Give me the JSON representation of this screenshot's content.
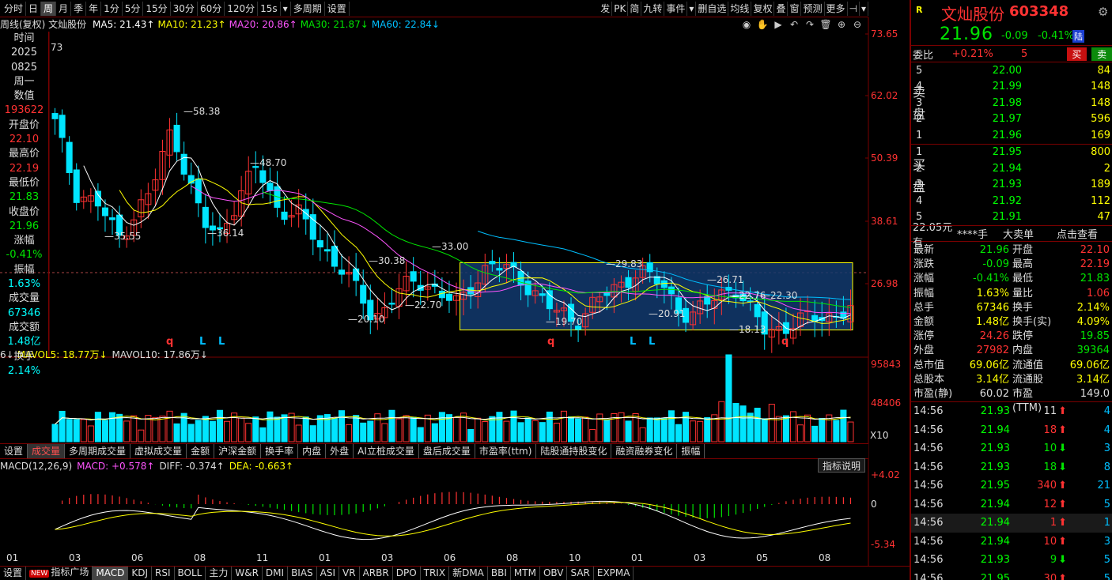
{
  "toolbar": {
    "left_items": [
      "分时",
      "日",
      "周",
      "月",
      "季",
      "年",
      "1分",
      "5分",
      "15分",
      "30分",
      "60分",
      "120分",
      "15s",
      "▾",
      "多周期",
      "设置"
    ],
    "active": "周",
    "right_items": [
      "发",
      "PK",
      "简",
      "九转",
      "事件",
      "▾",
      "删自选",
      "均线",
      "复权",
      "叠",
      "窗",
      "预测",
      "更多",
      "⊣",
      "▾"
    ]
  },
  "ma_line": {
    "title": "周线(复权) 文灿股份",
    "items": [
      {
        "text": "MA5: 21.43↑",
        "color": "#ffffff"
      },
      {
        "text": "MA10: 21.23↑",
        "color": "#ffff00"
      },
      {
        "text": "MA20: 20.86↑",
        "color": "#ff55ff"
      },
      {
        "text": "MA30: 21.87↓",
        "color": "#00e600"
      },
      {
        "text": "MA60: 22.84↓",
        "color": "#00bfff"
      }
    ]
  },
  "tools": [
    "◉",
    "✋",
    "▶",
    "↶",
    "↷",
    "🗑",
    "⊕",
    "⊖"
  ],
  "info_panel": [
    {
      "text": "时间",
      "color": "#ddd"
    },
    {
      "text": "2025",
      "color": "#ddd"
    },
    {
      "text": "0825",
      "color": "#ddd"
    },
    {
      "text": "周一",
      "color": "#ddd"
    },
    {
      "text": "数值",
      "color": "#ddd"
    },
    {
      "text": "193622",
      "color": "#ff3232"
    },
    {
      "text": "开盘价",
      "color": "#ddd"
    },
    {
      "text": "22.10",
      "color": "#ff3232"
    },
    {
      "text": "最高价",
      "color": "#ddd"
    },
    {
      "text": "22.19",
      "color": "#ff3232"
    },
    {
      "text": "最低价",
      "color": "#ddd"
    },
    {
      "text": "21.83",
      "color": "#00e600"
    },
    {
      "text": "收盘价",
      "color": "#ddd"
    },
    {
      "text": "21.96",
      "color": "#00e600"
    },
    {
      "text": "涨幅",
      "color": "#ddd"
    },
    {
      "text": "-0.41%",
      "color": "#00e600"
    },
    {
      "text": "振幅",
      "color": "#ddd"
    },
    {
      "text": "1.63%",
      "color": "#00ffff"
    },
    {
      "text": "成交量",
      "color": "#ddd"
    },
    {
      "text": "67346",
      "color": "#00ffff"
    },
    {
      "text": "成交额",
      "color": "#ddd"
    },
    {
      "text": "1.48亿",
      "color": "#00ffff"
    },
    {
      "text": "换手",
      "color": "#ddd"
    },
    {
      "text": "2.14%",
      "color": "#00ffff"
    }
  ],
  "info_header_value": "73",
  "price_axis": [
    "73.65",
    "62.02",
    "50.39",
    "38.61",
    "26.98"
  ],
  "vol_axis": [
    "95843",
    "48406"
  ],
  "vol_unit": "X10",
  "macd_axis": [
    "+4.02",
    "0",
    "-5.34"
  ],
  "x_axis": [
    "01",
    "03",
    "06",
    "08",
    "11",
    "01",
    "03",
    "06",
    "08",
    "10",
    "01",
    "03",
    "05",
    "08"
  ],
  "annotations": {
    "highs": [
      "58.38",
      "48.70",
      "33.00",
      "30.38",
      "29.83",
      "26.71",
      "22.76",
      "22.30"
    ],
    "lows": [
      "35.55",
      "36.14",
      "22.70",
      "20.10",
      "19.70",
      "20.91",
      "18.13"
    ]
  },
  "markers": [
    "q",
    "L",
    "L",
    "q",
    "L",
    "L",
    "q"
  ],
  "vol_line": {
    "prefix": "6↓",
    "items": [
      {
        "text": "MAVOL5: 18.77万↓",
        "color": "#ffff00"
      },
      {
        "text": "MAVOL10: 17.86万↓",
        "color": "#ddd"
      }
    ]
  },
  "sub_tabs": [
    "设置",
    "成交量",
    "多周期成交量",
    "虚拟成交量",
    "金额",
    "沪深金额",
    "换手率",
    "内盘",
    "外盘",
    "AI立桩成交量",
    "盘后成交量",
    "市盈率(ttm)",
    "陆股通持股变化",
    "融资融券变化",
    "振幅"
  ],
  "sub_tab_active": "成交量",
  "macd_line": {
    "items": [
      {
        "text": "MACD(12,26,9)",
        "color": "#ddd"
      },
      {
        "text": "MACD: +0.578↑",
        "color": "#ff55ff"
      },
      {
        "text": "DIFF: -0.374↑",
        "color": "#ddd"
      },
      {
        "text": "DEA: -0.663↑",
        "color": "#ffff00"
      }
    ]
  },
  "indicator_explain": "指标说明",
  "bottom_tabs": [
    "设置",
    "指标广场",
    "MACD",
    "KDJ",
    "RSI",
    "BOLL",
    "主力",
    "W&R",
    "DMI",
    "BIAS",
    "ASI",
    "VR",
    "ARBR",
    "DPO",
    "TRIX",
    "新DMA",
    "BBI",
    "MTM",
    "OBV",
    "SAR",
    "EXPMA"
  ],
  "bottom_active": "MACD",
  "bottom_new_badge": "NEW",
  "stock": {
    "badge": "R",
    "name": "文灿股份",
    "code": "603348",
    "price": "21.96",
    "change": "-0.09",
    "pct": "-0.41%",
    "tag": "陆"
  },
  "webi": {
    "label": "委比",
    "value": "+0.21%",
    "diff": "5",
    "buy": "买",
    "sell": "卖"
  },
  "sell_label": "卖\n\n盘",
  "buy_label": "买\n\n盘",
  "sells": [
    {
      "lvl": "5",
      "price": "22.00",
      "vol": "84"
    },
    {
      "lvl": "4",
      "price": "21.99",
      "vol": "148"
    },
    {
      "lvl": "3",
      "price": "21.98",
      "vol": "148"
    },
    {
      "lvl": "2",
      "price": "21.97",
      "vol": "596"
    },
    {
      "lvl": "1",
      "price": "21.96",
      "vol": "169"
    }
  ],
  "buys": [
    {
      "lvl": "1",
      "price": "21.95",
      "vol": "800"
    },
    {
      "lvl": "2",
      "price": "21.94",
      "vol": "2"
    },
    {
      "lvl": "3",
      "price": "21.93",
      "vol": "189"
    },
    {
      "lvl": "4",
      "price": "21.92",
      "vol": "112"
    },
    {
      "lvl": "5",
      "price": "21.91",
      "vol": "47"
    }
  ],
  "big_order": {
    "price": "22.05元有",
    "hands": "****手",
    "label": "大卖单",
    "link": "点击查看"
  },
  "quote": [
    {
      "k": "最新",
      "v": "21.96",
      "vc": "#00e600",
      "k2": "开盘",
      "v2": "22.10",
      "v2c": "#ff3232"
    },
    {
      "k": "涨跌",
      "v": "-0.09",
      "vc": "#00e600",
      "k2": "最高",
      "v2": "22.19",
      "v2c": "#ff3232"
    },
    {
      "k": "涨幅",
      "v": "-0.41%",
      "vc": "#00e600",
      "k2": "最低",
      "v2": "21.83",
      "v2c": "#00e600"
    },
    {
      "k": "振幅",
      "v": "1.63%",
      "vc": "#ffff00",
      "k2": "量比",
      "v2": "1.06",
      "v2c": "#ff3232"
    },
    {
      "k": "总手",
      "v": "67346",
      "vc": "#ffff00",
      "k2": "换手",
      "v2": "2.14%",
      "v2c": "#ffff00"
    },
    {
      "k": "金额",
      "v": "1.48亿",
      "vc": "#ffff00",
      "k2": "换手(实)",
      "v2": "4.09%",
      "v2c": "#ffff00"
    },
    {
      "k": "涨停",
      "v": "24.26",
      "vc": "#ff3232",
      "k2": "跌停",
      "v2": "19.85",
      "v2c": "#00e600"
    },
    {
      "k": "外盘",
      "v": "27982",
      "vc": "#ff3232",
      "k2": "内盘",
      "v2": "39364",
      "v2c": "#00e600"
    },
    {
      "k": "总市值",
      "v": "69.06亿",
      "vc": "#ffff00",
      "k2": "流通值",
      "v2": "69.06亿",
      "v2c": "#ffff00"
    },
    {
      "k": "总股本",
      "v": "3.14亿",
      "vc": "#ffff00",
      "k2": "流通股",
      "v2": "3.14亿",
      "v2c": "#ffff00"
    },
    {
      "k": "市盈(静)",
      "v": "60.02",
      "vc": "#ddd",
      "k2": "市盈(TTM)",
      "v2": "149.0",
      "v2c": "#ddd"
    }
  ],
  "ticks": [
    {
      "t": "14:56",
      "p": "21.93",
      "q": "11",
      "dir": "up",
      "qc": "#ddd",
      "c": "4"
    },
    {
      "t": "14:56",
      "p": "21.94",
      "q": "18",
      "dir": "up",
      "qc": "#ff3232",
      "c": "4"
    },
    {
      "t": "14:56",
      "p": "21.93",
      "q": "10",
      "dir": "down",
      "qc": "#00e600",
      "c": "3"
    },
    {
      "t": "14:56",
      "p": "21.93",
      "q": "18",
      "dir": "down",
      "qc": "#00e600",
      "c": "8"
    },
    {
      "t": "14:56",
      "p": "21.95",
      "q": "340",
      "dir": "up",
      "qc": "#ff3232",
      "c": "21"
    },
    {
      "t": "14:56",
      "p": "21.94",
      "q": "12",
      "dir": "up",
      "qc": "#ff3232",
      "c": "5"
    },
    {
      "t": "14:56",
      "p": "21.94",
      "q": "1",
      "dir": "up",
      "qc": "#ff3232",
      "c": "1"
    },
    {
      "t": "14:56",
      "p": "21.94",
      "q": "10",
      "dir": "up",
      "qc": "#ff3232",
      "c": "3"
    },
    {
      "t": "14:56",
      "p": "21.93",
      "q": "9",
      "dir": "down",
      "qc": "#00e600",
      "c": "5"
    },
    {
      "t": "14:56",
      "p": "21.95",
      "q": "30",
      "dir": "up",
      "qc": "#ff3232",
      "c": "5"
    }
  ]
}
